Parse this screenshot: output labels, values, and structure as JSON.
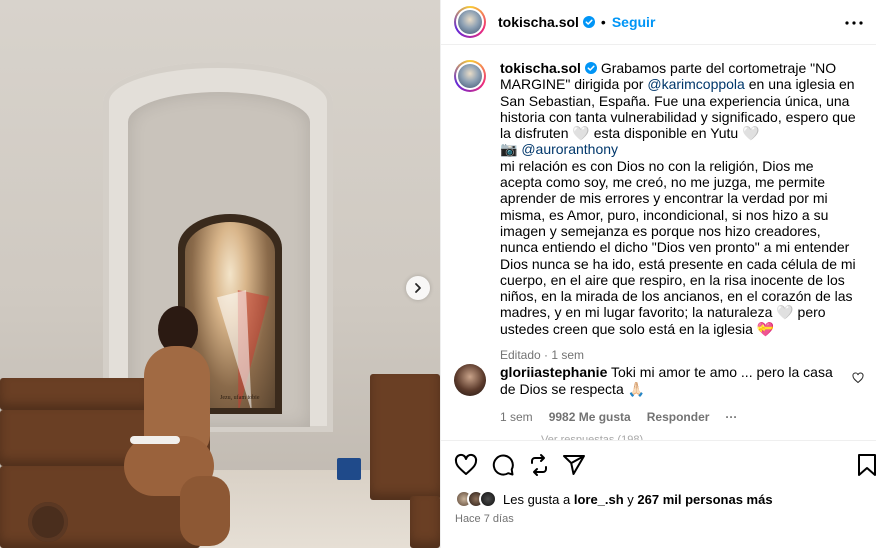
{
  "post": {
    "username": "tokischa.sol",
    "separator": "•",
    "follow_label": "Seguir",
    "more_icon": "more-horizontal-icon",
    "painting_caption": "Jezu, ufam tobie"
  },
  "caption": {
    "username": "tokischa.sol",
    "text_1": "Grabamos parte del cortometraje \"NO MARGINE\" dirigida por ",
    "mention_1": "@karimcoppola",
    "text_2": " en una iglesia en San Sebastian, España. Fue una experiencia única, una historia con tanta vulnerabilidad y significado, espero que la disfruten 🤍 esta disponible en Yutu 🤍",
    "camera": "📷 ",
    "mention_2": "@auroranthony",
    "text_3": "mi relación es con Dios no con la religión, Dios me acepta como soy, me creó, no me juzga, me permite aprender de mis errores y encontrar la verdad por mi misma, es Amor, puro, incondicional, si nos hizo a su imagen y semejanza es porque nos hizo creadores, nunca entiendo el dicho \"Dios ven pronto\" a mi entender Dios nunca se ha ido, está presente en cada célula de mi cuerpo, en el aire que respiro, en la risa inocente de los niños, en la mirada de los ancianos, en el corazón de las madres, y en mi lugar favorito; la naturaleza 🤍 pero ustedes creen que solo está en la iglesia 💝",
    "meta": "Editado · 1 sem"
  },
  "comment": {
    "username": "gloriiastephanie",
    "text": " Toki mi amor te amo ... pero la casa de Dios se respecta 🙏🏻",
    "time": "1 sem",
    "likes": "9982 Me gusta",
    "reply": "Responder",
    "more": "···",
    "faded_text": "Ver respuestas (198)"
  },
  "actions": {
    "icons": [
      "heart-icon",
      "comment-icon",
      "repost-icon",
      "share-icon",
      "bookmark-icon"
    ]
  },
  "likes": {
    "prefix": "Les gusta a ",
    "user": "lore_.sh",
    "middle": " y ",
    "count": "267 mil personas más"
  },
  "time_ago": "Hace 7 días",
  "colors": {
    "link": "#0095f6",
    "mention": "#00376b",
    "meta": "#737373",
    "verified": "#0095f6"
  }
}
